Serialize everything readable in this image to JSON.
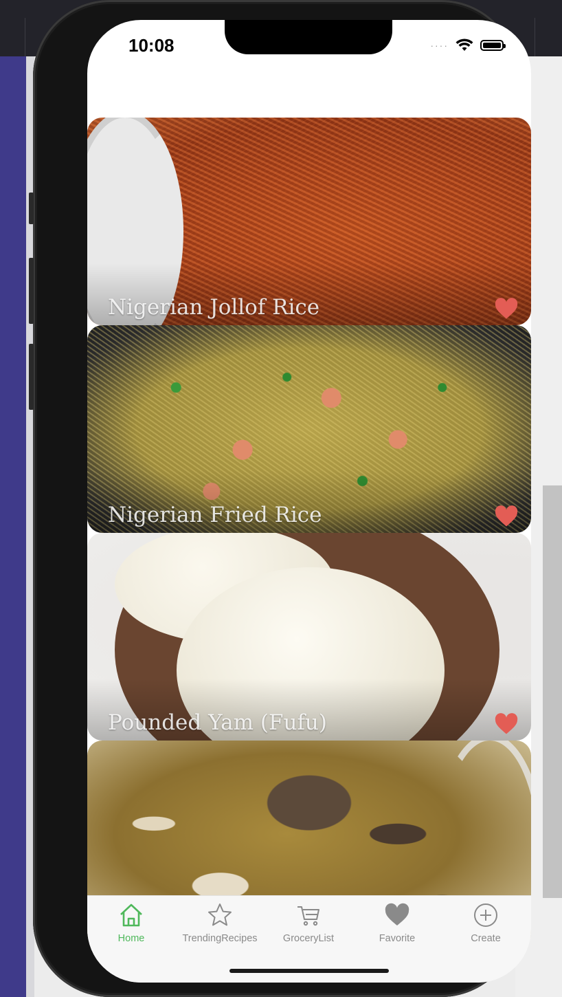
{
  "status_bar": {
    "time": "10:08"
  },
  "recipes": [
    {
      "title": "Nigerian Jollof Rice",
      "favorite": true
    },
    {
      "title": "Nigerian Fried Rice",
      "favorite": true
    },
    {
      "title": "Pounded Yam (Fufu)",
      "favorite": true
    },
    {
      "title": "",
      "favorite": false
    }
  ],
  "tabs": [
    {
      "label": "Home",
      "icon": "home-icon",
      "active": true
    },
    {
      "label": "TrendingRecipes",
      "icon": "star-icon",
      "active": false
    },
    {
      "label": "GroceryList",
      "icon": "cart-icon",
      "active": false
    },
    {
      "label": "Favorite",
      "icon": "heart-icon",
      "active": false
    },
    {
      "label": "Create",
      "icon": "plus-circle-icon",
      "active": false
    }
  ],
  "colors": {
    "accent_green": "#4fb85b",
    "heart_red": "#e35d55",
    "tab_inactive": "#8a8a8a"
  }
}
